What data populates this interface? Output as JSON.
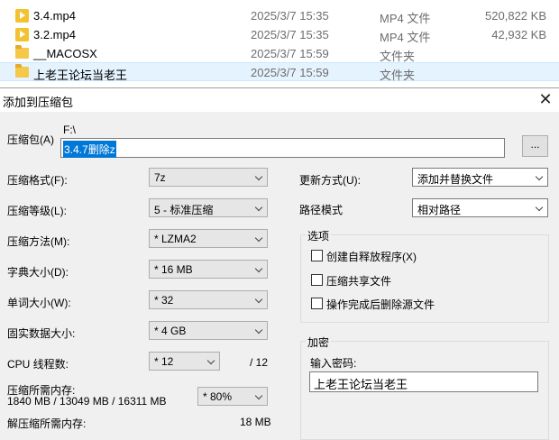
{
  "explorer": {
    "files": [
      {
        "name": "3.4.mp4",
        "date": "2025/3/7 15:35",
        "type": "MP4 文件",
        "size": "520,822 KB",
        "icon": "video-file-icon"
      },
      {
        "name": "3.2.mp4",
        "date": "2025/3/7 15:35",
        "type": "MP4 文件",
        "size": "42,932 KB",
        "icon": "video-file-icon"
      },
      {
        "name": "__MACOSX",
        "date": "2025/3/7 15:59",
        "type": "文件夹",
        "size": "",
        "icon": "folder-icon"
      },
      {
        "name": "上老王论坛当老王",
        "date": "2025/3/7 15:59",
        "type": "文件夹",
        "size": "",
        "icon": "folder-icon"
      }
    ]
  },
  "dialog": {
    "title": "添加到压缩包",
    "close_glyph": "✕",
    "archive": {
      "label": "压缩包(A)",
      "path": "F:\\",
      "name": "3.4.7删除z",
      "browse_label": "..."
    },
    "format": {
      "label": "压缩格式(F):",
      "value": "7z"
    },
    "level": {
      "label": "压缩等级(L):",
      "value": "5 - 标准压缩"
    },
    "method": {
      "label": "压缩方法(M):",
      "value": "* LZMA2"
    },
    "dict": {
      "label": "字典大小(D):",
      "value": "* 16 MB"
    },
    "word": {
      "label": "单词大小(W):",
      "value": "* 32"
    },
    "solid": {
      "label": "固实数据大小:",
      "value": "* 4 GB"
    },
    "threads": {
      "label": "CPU 线程数:",
      "value": "* 12",
      "max": "/ 12"
    },
    "memory": {
      "label": "压缩所需内存:",
      "detail": "1840 MB / 13049 MB / 16311 MB",
      "value": "* 80%"
    },
    "decompress_mem": {
      "label": "解压缩所需内存:",
      "value": "18 MB"
    },
    "update_mode": {
      "label": "更新方式(U):",
      "value": "添加并替换文件"
    },
    "path_mode": {
      "label": "路径模式",
      "value": "相对路径"
    },
    "options": {
      "title": "选项",
      "items": [
        {
          "label": "创建自释放程序(X)",
          "checked": false
        },
        {
          "label": "压缩共享文件",
          "checked": false
        },
        {
          "label": "操作完成后删除源文件",
          "checked": false
        }
      ]
    },
    "encryption": {
      "title": "加密",
      "password_label": "输入密码:",
      "password_value": "上老王论坛当老王"
    }
  },
  "colors": {
    "selection": "#0078d7",
    "row_selected": "#e5f3ff",
    "video_icon": "#f2c230",
    "folder_icon": "#f5c84a"
  }
}
